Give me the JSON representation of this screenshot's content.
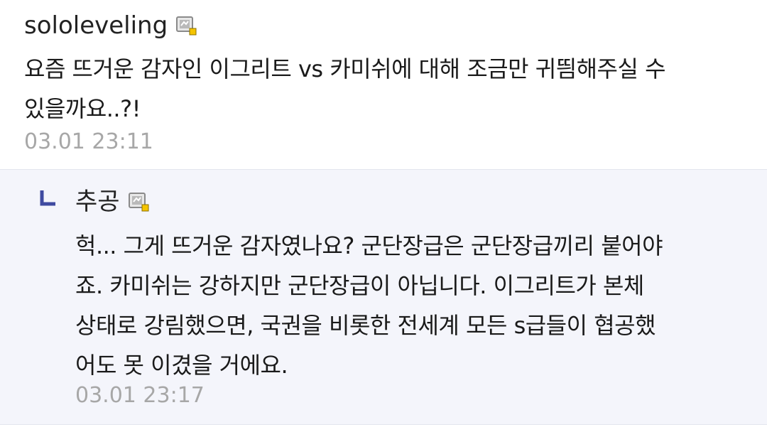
{
  "comment": {
    "author": "sololeveling",
    "author_icon": "member-grade-icon",
    "lines": [
      "요즘 뜨거운 감자인 이그리트 vs 카미쉬에 대해 조금만 귀띔해주실 수",
      "있을까요..?!"
    ],
    "timestamp": "03.01 23:11"
  },
  "reply": {
    "indicator_icon": "reply-arrow-icon",
    "author": "추공",
    "author_icon": "member-grade-icon",
    "lines": [
      "헉... 그게 뜨거운 감자였나요? 군단장급은 군단장급끼리 붙어야",
      "죠. 카미쉬는 강하지만 군단장급이 아닙니다. 이그리트가 본체",
      "상태로 강림했으면, 국권을 비롯한 전세계 모든 s급들이 협공했",
      "어도 못 이겼을 거에요."
    ],
    "timestamp": "03.01 23:17"
  },
  "colors": {
    "reply_background": "#f4f5fb",
    "timestamp": "#a7a7a7",
    "reply_arrow": "#3f4aa0"
  }
}
